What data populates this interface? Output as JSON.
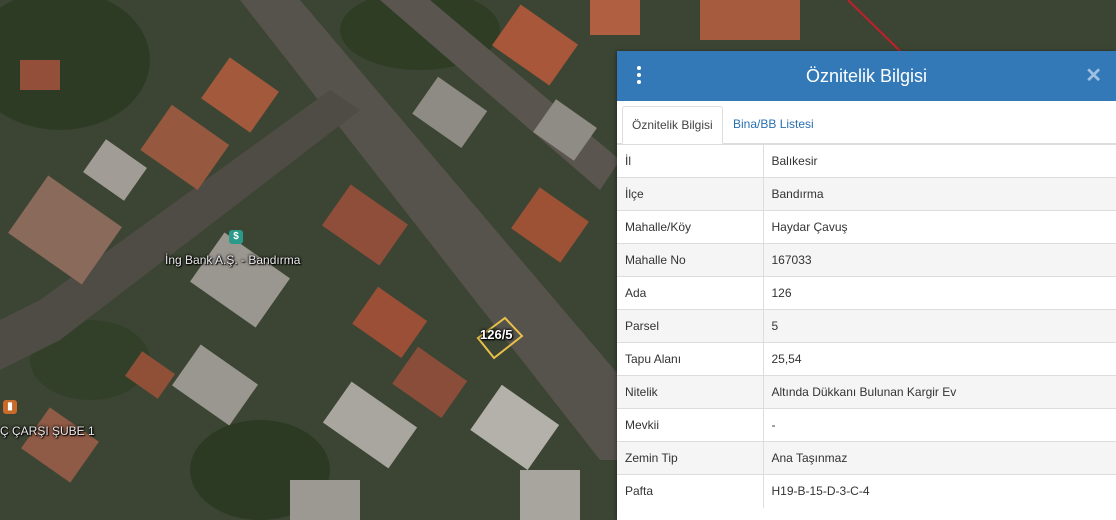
{
  "map": {
    "bank_label": "İng Bank A.Ş. - Bandırma",
    "branch_label": "Ç ÇARŞI ŞUBE 1",
    "parcel_label": "126/5",
    "bank_icon": "bank-icon",
    "branch_icon": "branch-icon"
  },
  "panel": {
    "title": "Öznitelik Bilgisi",
    "menu_icon": "kebab-menu-icon",
    "close_icon": "close-icon",
    "close_glyph": "✕",
    "tabs": [
      {
        "label": "Öznitelik Bilgisi",
        "active": true
      },
      {
        "label": "Bina/BB Listesi",
        "active": false
      }
    ],
    "rows": [
      {
        "key": "İl",
        "value": "Balıkesir"
      },
      {
        "key": "İlçe",
        "value": "Bandırma"
      },
      {
        "key": "Mahalle/Köy",
        "value": "Haydar Çavuş"
      },
      {
        "key": "Mahalle No",
        "value": "167033"
      },
      {
        "key": "Ada",
        "value": "126"
      },
      {
        "key": "Parsel",
        "value": "5"
      },
      {
        "key": "Tapu Alanı",
        "value": "25,54"
      },
      {
        "key": "Nitelik",
        "value": "Altında Dükkanı Bulunan Kargir Ev"
      },
      {
        "key": "Mevkii",
        "value": "-"
      },
      {
        "key": "Zemin Tip",
        "value": "Ana Taşınmaz"
      },
      {
        "key": "Pafta",
        "value": "H19-B-15-D-3-C-4"
      }
    ]
  },
  "colors": {
    "header": "#3379b7",
    "tab_link": "#2a6fb0",
    "parcel_outline": "#e8c04a",
    "boundary_line": "#c0202a"
  }
}
